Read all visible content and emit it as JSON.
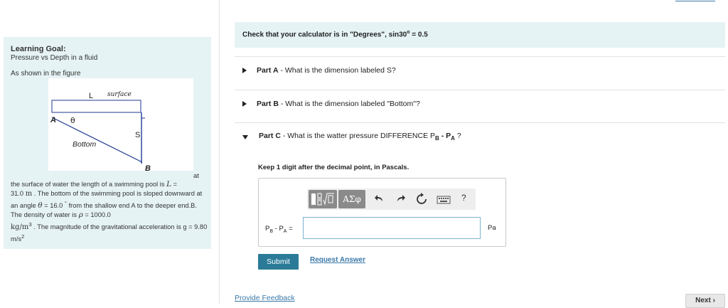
{
  "left": {
    "goal_title": "Learning Goal:",
    "goal_subtitle": "Pressure vs Depth in a fluid",
    "intro": "As shown in the figure",
    "figure": {
      "label_L": "L",
      "label_surface": "surface",
      "label_A": "A",
      "label_theta": "θ",
      "label_S": "S",
      "label_bottom": "Bottom",
      "label_B": "B"
    },
    "trailing_at": "at",
    "body": {
      "t1": "the surface of water the length of a swimming pool is ",
      "L_var": "L",
      "t2": " =",
      "t3": "31.0 ",
      "m_unit": "m",
      "t4": " . The bottom of the swimming pool is sloped downward at an angle ",
      "theta_var": "θ",
      "t5": " = 16.0 ",
      "deg": "°",
      "t6": " from the shallow end A to the deeper end.B. The density of water is ",
      "rho_var": "ρ",
      "t7": " = 1000.0",
      "density_unit": "kg/m",
      "density_exp": "3",
      "t8": " . The magnitude of the gravitational acceleration is g = 9.80 m/s",
      "g_exp": "2"
    }
  },
  "calc_notice": {
    "text": "Check that your calculator is in \"Degrees\", sin30",
    "sup": "o",
    "tail": " = 0.5"
  },
  "parts": {
    "a": {
      "label": "Part A",
      "question": " - What is the dimension labeled S?"
    },
    "b": {
      "label": "Part B",
      "question": " - What is the dimension labeled \"Bottom\"?"
    },
    "c": {
      "label": "Part C",
      "question": " - What is the watter pressure DIFFERENCE P",
      "sub1": "B",
      "mid": " - P",
      "sub2": "A",
      "end": " ?"
    }
  },
  "instruction": "Keep 1 digit after the decimal point, in Pascals.",
  "toolbar": {
    "templates_icon": "fraction-root-template-icon",
    "symbols_label": "ΑΣφ",
    "undo_icon": "undo-icon",
    "redo_icon": "redo-icon",
    "reset_icon": "reset-icon",
    "keyboard_icon": "keyboard-icon",
    "help_label": "?"
  },
  "answer": {
    "label_p": "P",
    "label_sub1": "B",
    "label_mid": " - P",
    "label_sub2": "A",
    "label_eq": " =",
    "value": "",
    "unit": "Pa"
  },
  "buttons": {
    "submit": "Submit",
    "request_answer": "Request Answer",
    "provide_feedback": "Provide Feedback",
    "next": "Next"
  },
  "colors": {
    "panel_bg": "#e6f3f5",
    "accent": "#2b7b98",
    "link": "#3a78a8"
  }
}
